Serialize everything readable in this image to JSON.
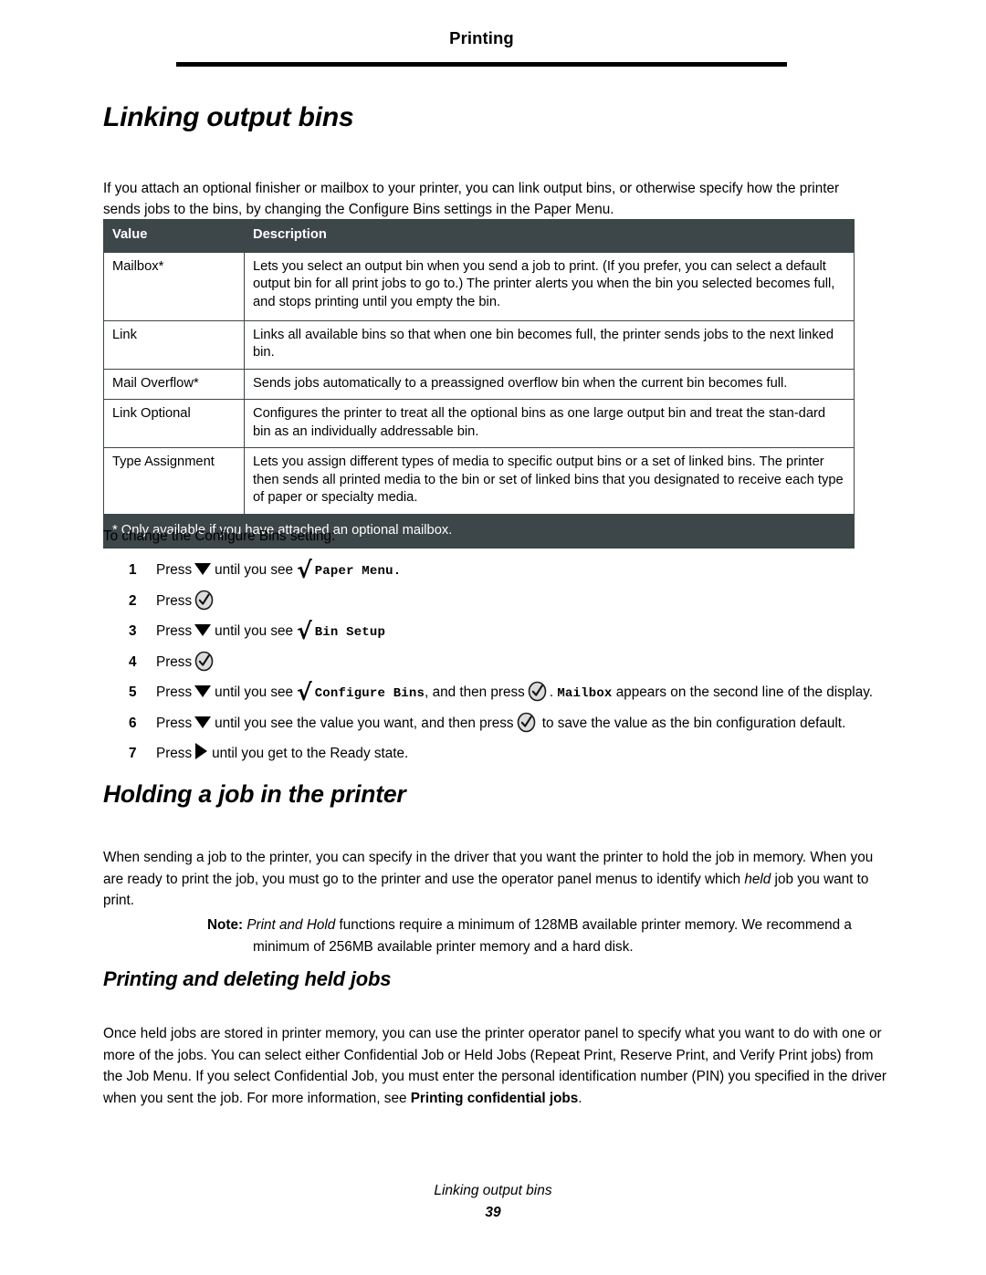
{
  "header": {
    "running_title": "Printing"
  },
  "title": "Linking output bins",
  "intro_paragraph": "If you attach an optional finisher or mailbox to your printer, you can link output bins, or otherwise specify how the printer sends jobs to the bins, by changing the Configure Bins settings in the Paper Menu.",
  "table": {
    "columns": [
      "Value",
      "Description"
    ],
    "rows": [
      {
        "value": "Mailbox*",
        "description": "Lets you select an output bin when you send a job to print. (If you prefer, you can select a default output bin for all print jobs to go to.) The printer alerts you when the bin you selected becomes full, and stops printing until you empty the bin."
      },
      {
        "value": "Link",
        "description": "Links all available bins so that when one bin becomes full, the printer sends jobs to the next linked bin."
      },
      {
        "value": "Mail Overflow*",
        "description": "Sends jobs automatically to a preassigned overflow bin when the current bin becomes full."
      },
      {
        "value": "Link Optional",
        "description": "Configures the printer to treat all the optional bins as one large output bin and treat the stan-dard bin as an individually addressable bin."
      },
      {
        "value": "Type Assignment",
        "description": "Lets you assign different types of media to specific output bins or a set of linked bins. The printer then sends all printed media to the bin or set of linked bins that you designated to receive each type of paper or specialty media."
      }
    ],
    "footnote": "* Only available if you have attached an optional mailbox.",
    "header_bg": "#3d4649",
    "header_fg": "#ffffff"
  },
  "procedure": {
    "lead_in": "To change the Configure Bins setting:",
    "steps": [
      {
        "num": "1",
        "press_label": "Press",
        "icon_1": "down-arrow-icon",
        "mid_text": "until you see",
        "icon_2": "check-icon",
        "menu_text": "Paper Menu.",
        "tail_text": ""
      },
      {
        "num": "2",
        "press_label": "Press",
        "icon_1": "select-button-icon"
      },
      {
        "num": "3",
        "press_label": "Press",
        "icon_1": "down-arrow-icon",
        "mid_text": "until you see",
        "icon_2": "check-icon",
        "menu_text": "Bin Setup",
        "tail_text": ""
      },
      {
        "num": "4",
        "press_label": "Press",
        "icon_1": "select-button-icon"
      },
      {
        "num": "5",
        "press_label": "Press",
        "icon_1": "down-arrow-icon",
        "mid_text": "until you see",
        "icon_2": "check-icon",
        "menu_text": "Configure Bins",
        "text_after_menu": ", and then press",
        "icon_3": "select-button-icon",
        "text_after_icon3": ".",
        "menu_text_2": "Mailbox",
        "tail_text": "appears on the second line of the display."
      },
      {
        "num": "6",
        "press_label": "Press",
        "icon_1": "down-arrow-icon",
        "mid_text": "until you see the value you want, and then press",
        "icon_3": "select-button-icon",
        "tail_text": "to save the value as the bin configuration default."
      },
      {
        "num": "7",
        "press_label": "Press",
        "icon_1": "right-arrow-icon",
        "tail_text": "until you get to the Ready state."
      }
    ]
  },
  "section_hold": {
    "title": "Holding a job in the printer",
    "paragraph_a": "When sending a job to the printer, you can specify in the driver that you want the printer to hold the job in memory. When you are ready to print the job, you must go to the printer and use the operator panel menus to identify which ",
    "paragraph_a_italic": "held",
    "paragraph_a_cont": " job you want to print.",
    "note_label": "Note:",
    "note_italic": "Print and Hold",
    "note_text": " functions require a minimum of 128MB available printer memory. We recommend a minimum of 256MB available printer memory and a hard disk."
  },
  "section_held_jobs": {
    "title": "Printing and deleting held jobs",
    "paragraph": "Once held jobs are stored in printer memory, you can use the printer operator panel to specify what you want to do with one or more of the jobs. You can select either Confidential Job or Held Jobs (Repeat Print, Reserve Print, and Verify Print jobs) from the Job Menu. If you select Confidential Job, you must enter the personal identification number (PIN) you specified in the driver when you sent the job. For more information, see ",
    "paragraph_bold": "Printing confidential jobs",
    "paragraph_end": "."
  },
  "footer": {
    "title": "Linking output bins",
    "page_number": "39"
  }
}
